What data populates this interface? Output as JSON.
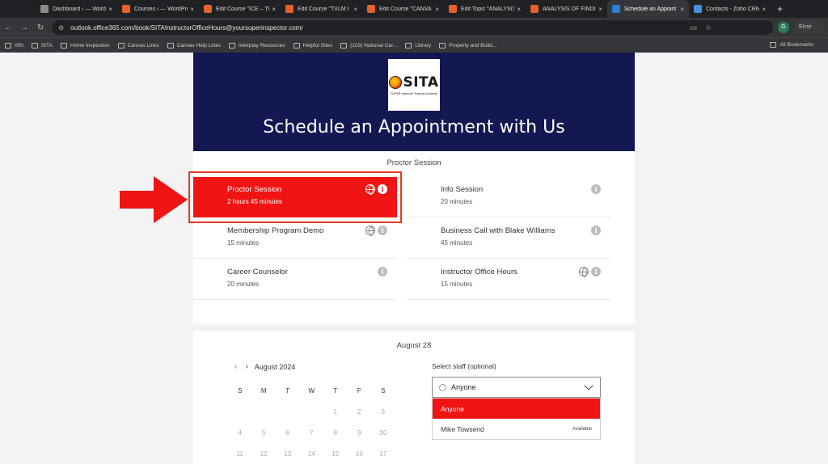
{
  "browser": {
    "tabs": [
      {
        "label": "Dashboard ‹ — Word",
        "icon": "wordpress-icon",
        "active": false
      },
      {
        "label": "Courses ‹ — WordPre",
        "icon": "sita-favicon-icon",
        "active": false
      },
      {
        "label": "Edit Course \"ICE – TI",
        "icon": "sita-favicon-icon",
        "active": false
      },
      {
        "label": "Edit Course \"TXLM I",
        "icon": "sita-favicon-icon",
        "active": false
      },
      {
        "label": "Edit Course \"CANVA",
        "icon": "sita-favicon-icon",
        "active": false
      },
      {
        "label": "Edit Topic \"ANALYSIS",
        "icon": "sita-favicon-icon",
        "active": false
      },
      {
        "label": "ANALYSIS OF FINDIN",
        "icon": "sita-favicon-icon",
        "active": false
      },
      {
        "label": "Schedule an Appoint",
        "icon": "bookings-icon",
        "active": true
      },
      {
        "label": "Contacts - Zoho CRM",
        "icon": "zoho-icon",
        "active": false
      }
    ],
    "url": "outlook.office365.com/book/SITAInstructorOfficeHours@yoursuperinspector.com/",
    "profile_initial": "G",
    "error_label": "Error",
    "bookmarks": [
      "ISN",
      "SITA",
      "Home Inspection",
      "Canvas Links",
      "Canvas Help Links",
      "Interplay Resources",
      "Helpful Sites",
      "(103) National Cer...",
      "Library",
      "Property and Build..."
    ],
    "all_bookmarks_label": "All Bookmarks"
  },
  "hero": {
    "logo_word": "SITA",
    "logo_tagline": "SUPER Inspector Training Academy",
    "title": "Schedule an Appointment with Us"
  },
  "services": {
    "header": "Proctor Session",
    "items": [
      {
        "name": "Proctor Session",
        "duration": "2 hours 45 minutes",
        "globe": true,
        "selected": true
      },
      {
        "name": "Info Session",
        "duration": "20 minutes",
        "globe": false,
        "selected": false
      },
      {
        "name": "Membership Program Demo",
        "duration": "15 minutes",
        "globe": true,
        "selected": false
      },
      {
        "name": "Business Call with Blake Williams",
        "duration": "45 minutes",
        "globe": false,
        "selected": false
      },
      {
        "name": "Career Counselor",
        "duration": "20 minutes",
        "globe": false,
        "selected": false
      },
      {
        "name": "Instructor Office Hours",
        "duration": "15 minutes",
        "globe": true,
        "selected": false
      }
    ]
  },
  "date_header": "August 28",
  "calendar": {
    "month_label": "August 2024",
    "weekdays": [
      "S",
      "M",
      "T",
      "W",
      "T",
      "F",
      "S"
    ],
    "weeks": [
      [
        "",
        "",
        "",
        "",
        "1",
        "2",
        "3"
      ],
      [
        "4",
        "5",
        "6",
        "7",
        "8",
        "9",
        "10"
      ],
      [
        "11",
        "12",
        "13",
        "14",
        "15",
        "16",
        "17"
      ]
    ]
  },
  "staff": {
    "label": "Select staff (optional)",
    "selected": "Anyone",
    "options": [
      {
        "name": "Anyone",
        "status": "",
        "selected": true
      },
      {
        "name": "Mike Towsend",
        "status": "Available",
        "selected": false
      }
    ]
  },
  "colors": {
    "accent_red": "#f01414",
    "hero_navy": "#141852",
    "annotation_red": "#e53a1f"
  }
}
